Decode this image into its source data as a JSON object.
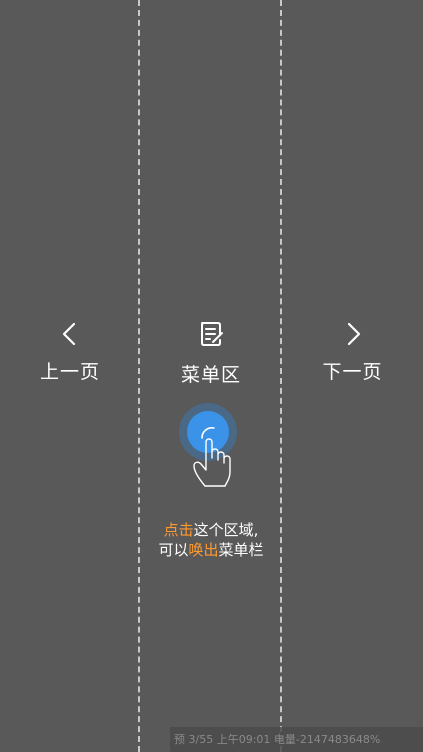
{
  "nav": {
    "prev_label": "上一页",
    "menu_label": "菜单区",
    "next_label": "下一页"
  },
  "icons": {
    "prev": "chevron-left-icon",
    "menu": "document-edit-icon",
    "next": "chevron-right-icon",
    "gesture": "tap-hand-icon"
  },
  "hint": {
    "line1_highlight": "点击",
    "line1_rest": "这个区域,",
    "line2_prefix": "可以",
    "line2_highlight": "唤出",
    "line2_rest": "菜单栏"
  },
  "status": {
    "text": "预 3/55 上午09:01 电量-2147483648%"
  },
  "colors": {
    "background": "#595959",
    "highlight": "#ff9a2e",
    "tap_circle": "#2e86de",
    "divider": "#c8c8c8"
  }
}
